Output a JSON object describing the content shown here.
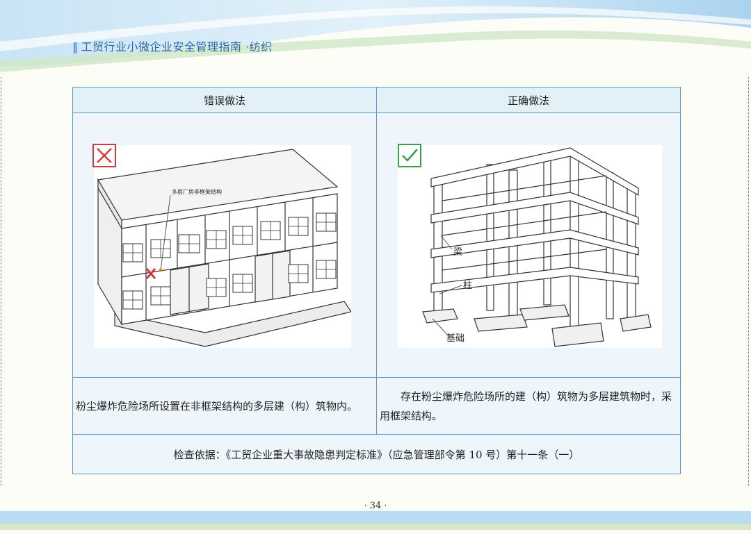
{
  "header": {
    "title": "工贸行业小微企业安全管理指南 ·纺织"
  },
  "table": {
    "wrong_header": "错误做法",
    "right_header": "正确做法",
    "wrong_desc": "粉尘爆炸危险场所设置在非框架结构的多层建（构）筑物内。",
    "right_desc": "存在粉尘爆炸危险场所的建（构）筑物为多层建筑物时，采用框架结构。",
    "basis": "检查依据：《工贸企业重大事故隐患判定标准》（应急管理部令第 10 号）第十一条（一）"
  },
  "left_image": {
    "label": "多层厂房非框架结构"
  },
  "right_image": {
    "label_beam": "梁",
    "label_column": "柱",
    "label_foundation": "基础"
  },
  "marks": {
    "wrong_icon": "x-mark-icon",
    "right_icon": "check-mark-icon"
  },
  "colors": {
    "accent": "#2a6aa8",
    "wrong": "#d23b3b",
    "right": "#3f9a4a",
    "table_border": "#5a95c8"
  },
  "footer": {
    "page": "· 34 ·"
  }
}
